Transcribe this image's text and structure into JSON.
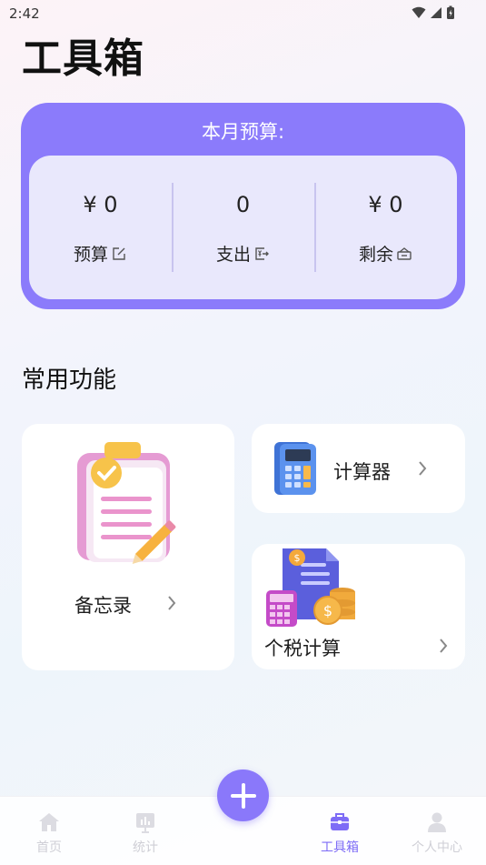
{
  "status_bar": {
    "time": "2:42"
  },
  "header": {
    "title": "工具箱"
  },
  "budget": {
    "title": "本月预算:",
    "items": [
      {
        "value": "¥ 0",
        "label": "预算",
        "icon": "edit-icon"
      },
      {
        "value": "0",
        "label": "支出",
        "icon": "export-yen-icon"
      },
      {
        "value": "¥ 0",
        "label": "剩余",
        "icon": "wallet-icon"
      }
    ]
  },
  "functions": {
    "title": "常用功能",
    "memo": {
      "label": "备忘录",
      "icon": "clipboard-checklist-icon"
    },
    "calculator": {
      "label": "计算器",
      "icon": "calculator-icon"
    },
    "tax": {
      "label": "个税计算",
      "icon": "tax-document-coins-icon"
    }
  },
  "tabbar": {
    "items": [
      {
        "label": "首页",
        "icon": "home-icon",
        "active": false
      },
      {
        "label": "统计",
        "icon": "chart-icon",
        "active": false
      },
      {
        "label": "工具箱",
        "icon": "toolbox-icon",
        "active": true
      },
      {
        "label": "个人中心",
        "icon": "user-icon",
        "active": false
      }
    ],
    "fab_icon": "plus-icon"
  },
  "colors": {
    "accent": "#8b7bfb",
    "card_inner": "#e9e8fc",
    "active_tab": "#7e6cf6"
  }
}
